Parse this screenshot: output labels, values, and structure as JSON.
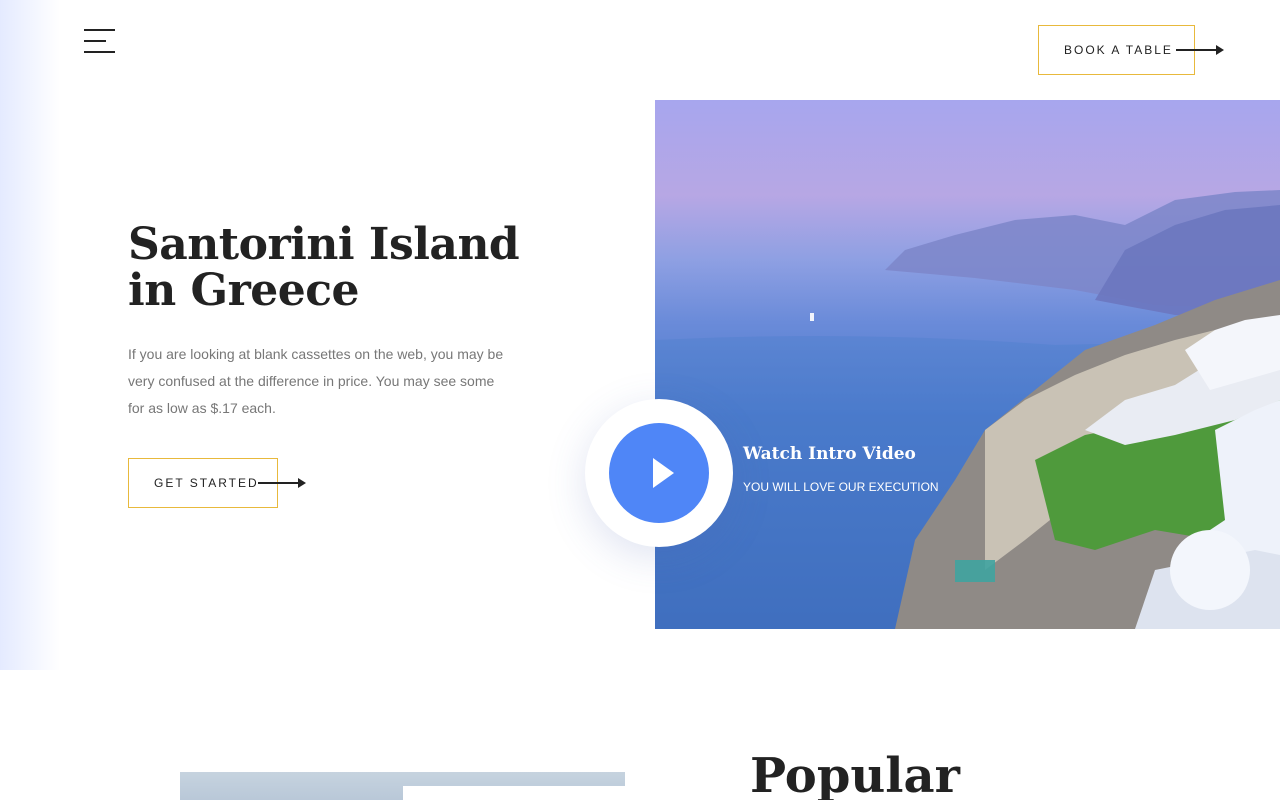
{
  "header": {
    "menu_icon": "hamburger-menu-icon",
    "book_button_label": "BOOK A TABLE",
    "accent_color": "#e8b93c"
  },
  "hero": {
    "title": "Santorini Island in Greece",
    "description": "If you are looking at blank cassettes on the web, you may be very confused at the difference in price. You may see some for as low as $.17 each.",
    "cta_label": "GET STARTED"
  },
  "video": {
    "title": "Watch Intro Video",
    "subtitle": "YOU WILL LOVE OUR EXECUTION",
    "play_icon": "play-icon",
    "button_color": "#4f86f7"
  },
  "next_section": {
    "title": "Popular"
  }
}
